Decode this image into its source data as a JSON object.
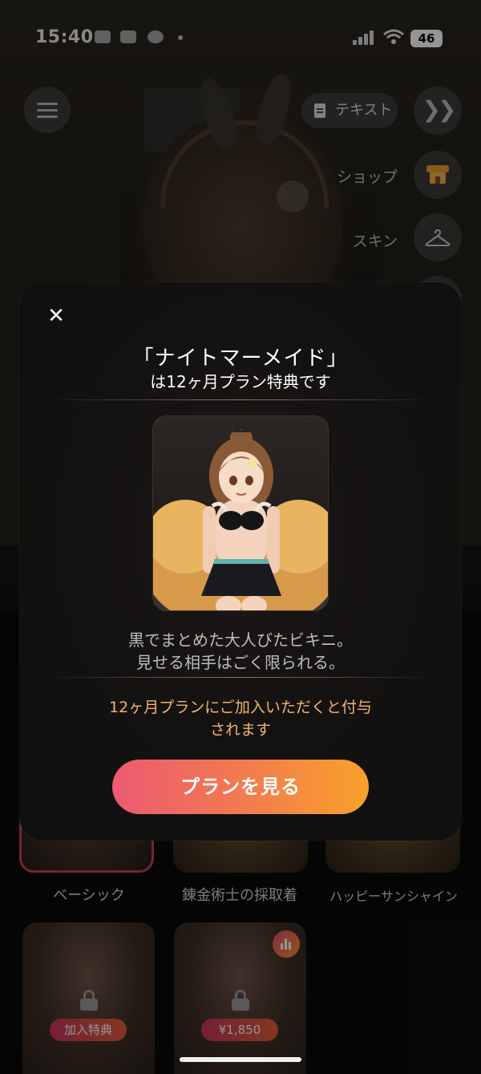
{
  "status_bar": {
    "time": "15:40",
    "battery": "46"
  },
  "top_controls": {
    "text_button": "テキスト",
    "skip_icon": "chevrons-right-icon",
    "menu_icon": "menu-icon"
  },
  "side_menu": {
    "shop_label": "ショップ",
    "skin_label": "スキン"
  },
  "outfits": [
    {
      "label": "ベーシック",
      "selected": true
    },
    {
      "label": "錬金術士の採取着",
      "selected": false
    },
    {
      "label": "ハッピーサンシャイン",
      "selected": false
    }
  ],
  "locked_outfits": [
    {
      "badge": "加入特典"
    },
    {
      "badge": "¥1,850"
    }
  ],
  "modal": {
    "close_icon": "close-icon",
    "title": "「ナイトマーメイド」",
    "subtitle": "は12ヶ月プラン特典です",
    "description_line1": "黒でまとめた大人びたビキニ。",
    "description_line2": "見せる相手はごく限られる。",
    "note_line1": "12ヶ月プランにご加入いただくと付与",
    "note_line2": "されます",
    "cta_label": "プランを見る"
  },
  "colors": {
    "accent_gradient_start": "#ec5a72",
    "accent_gradient_end": "#f9a12a",
    "note_text": "#f4b46e",
    "selected_border": "#c7424f"
  }
}
